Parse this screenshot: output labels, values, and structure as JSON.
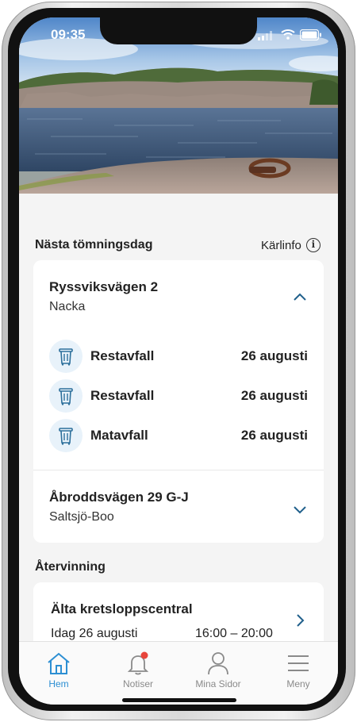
{
  "status": {
    "time": "09:35"
  },
  "schedule": {
    "title": "Nästa tömningsdag",
    "info_label": "Kärlinfo",
    "info_icon": "info-icon",
    "addresses": [
      {
        "street": "Ryssviksvägen 2",
        "city": "Nacka",
        "expanded": true,
        "pickups": [
          {
            "type": "Restavfall",
            "date": "26 augusti",
            "icon": "trash-bin-icon"
          },
          {
            "type": "Restavfall",
            "date": "26 augusti",
            "icon": "trash-bin-icon"
          },
          {
            "type": "Matavfall",
            "date": "26 augusti",
            "icon": "trash-bin-icon"
          }
        ]
      },
      {
        "street": "Åbroddsvägen 29 G-J",
        "city": "Saltsjö-Boo",
        "expanded": false,
        "pickups": []
      }
    ]
  },
  "recycling": {
    "title": "Återvinning",
    "center": {
      "name": "Älta kretsloppscentral",
      "day": "Idag  26 augusti",
      "hours": "16:00 – 20:00"
    }
  },
  "tabbar": {
    "items": [
      {
        "label": "Hem",
        "icon": "home-icon",
        "active": true
      },
      {
        "label": "Notiser",
        "icon": "bell-icon",
        "active": false,
        "badge": true
      },
      {
        "label": "Mina Sidor",
        "icon": "person-icon",
        "active": false
      },
      {
        "label": "Meny",
        "icon": "hamburger-menu-icon",
        "active": false
      }
    ]
  },
  "colors": {
    "accent": "#2c8fd3",
    "chevron": "#1f5f8b",
    "badge": "#e8453c",
    "bin_bg": "#e8f2fa"
  }
}
